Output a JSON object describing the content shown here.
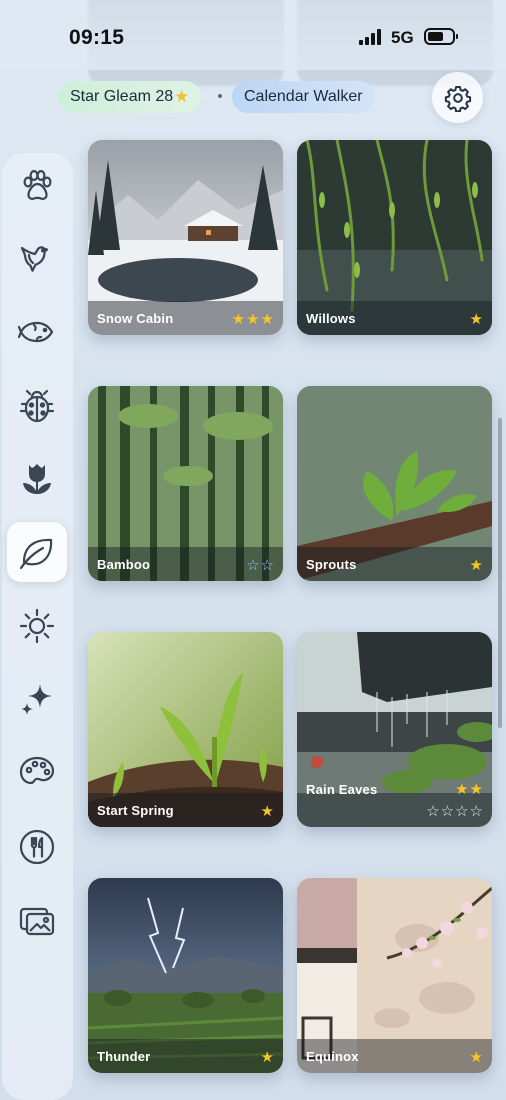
{
  "status_bar": {
    "time": "09:15",
    "network": "5G"
  },
  "header": {
    "stars_chip": {
      "label": "Star Gleam 28"
    },
    "calendar_chip": {
      "label": "Calendar Walker"
    }
  },
  "rail": {
    "items": [
      {
        "icon": "paw-icon",
        "active": false
      },
      {
        "icon": "bird-icon",
        "active": false
      },
      {
        "icon": "fish-icon",
        "active": false
      },
      {
        "icon": "ladybug-icon",
        "active": false
      },
      {
        "icon": "tulip-icon",
        "active": false
      },
      {
        "icon": "leaf-icon",
        "active": true
      },
      {
        "icon": "sun-icon",
        "active": false
      },
      {
        "icon": "sparkle-icon",
        "active": false
      },
      {
        "icon": "palette-icon",
        "active": false
      },
      {
        "icon": "fork-knife-icon",
        "active": false
      },
      {
        "icon": "gallery-icon",
        "active": false
      }
    ]
  },
  "cards": [
    {
      "title": "Snow Cabin",
      "stars_earned": 3,
      "stars_total": 3
    },
    {
      "title": "Willows",
      "stars_earned": 1,
      "stars_total": 1
    },
    {
      "title": "Bamboo",
      "stars_earned": 0,
      "stars_total": 2
    },
    {
      "title": "Sprouts",
      "stars_earned": 1,
      "stars_total": 1
    },
    {
      "title": "Start Spring",
      "stars_earned": 1,
      "stars_total": 1
    },
    {
      "title": "Rain Eaves",
      "stars_earned": 2,
      "stars_total": 4
    },
    {
      "title": "Thunder",
      "stars_earned": 1,
      "stars_total": 1
    },
    {
      "title": "Equinox",
      "stars_earned": 1,
      "stars_total": 1
    }
  ],
  "colors": {
    "accent_star": "#f6c624",
    "icon_stroke": "#3b4654"
  }
}
